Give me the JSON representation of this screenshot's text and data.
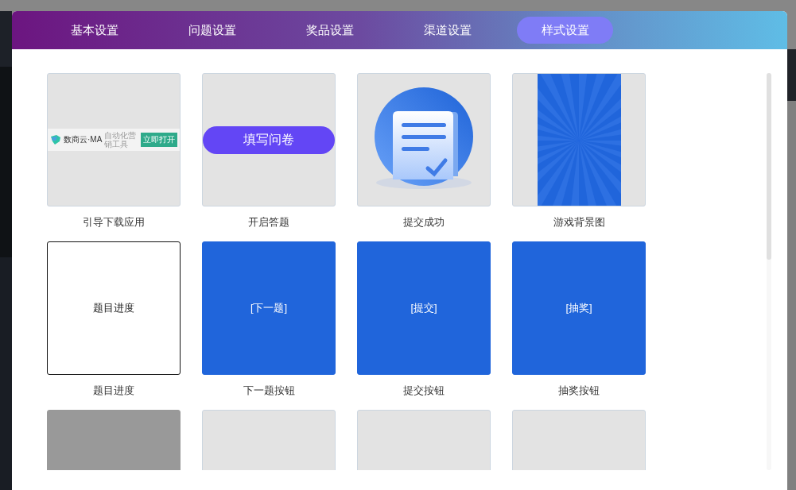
{
  "tabs": [
    {
      "label": "基本设置",
      "selected": false
    },
    {
      "label": "问题设置",
      "selected": false
    },
    {
      "label": "奖品设置",
      "selected": false
    },
    {
      "label": "渠道设置",
      "selected": false
    },
    {
      "label": "样式设置",
      "selected": true
    }
  ],
  "items": [
    {
      "kind": "banner",
      "label": "引导下载应用",
      "brand": "数商云·MA",
      "slogan": "自动化营销工具",
      "action": "立即打开"
    },
    {
      "kind": "pill",
      "label": "开启答题",
      "text": "填写问卷"
    },
    {
      "kind": "success",
      "label": "提交成功"
    },
    {
      "kind": "rays",
      "label": "游戏背景图"
    },
    {
      "kind": "outlined",
      "label": "题目进度",
      "text": "题目进度"
    },
    {
      "kind": "blue",
      "label": "下一题按钮",
      "text": "[下一题]"
    },
    {
      "kind": "blue",
      "label": "提交按钮",
      "text": "[提交]"
    },
    {
      "kind": "blue",
      "label": "抽奖按钮",
      "text": "[抽奖]"
    },
    {
      "kind": "gray"
    },
    {
      "kind": "blank"
    },
    {
      "kind": "blank"
    },
    {
      "kind": "blank"
    }
  ]
}
